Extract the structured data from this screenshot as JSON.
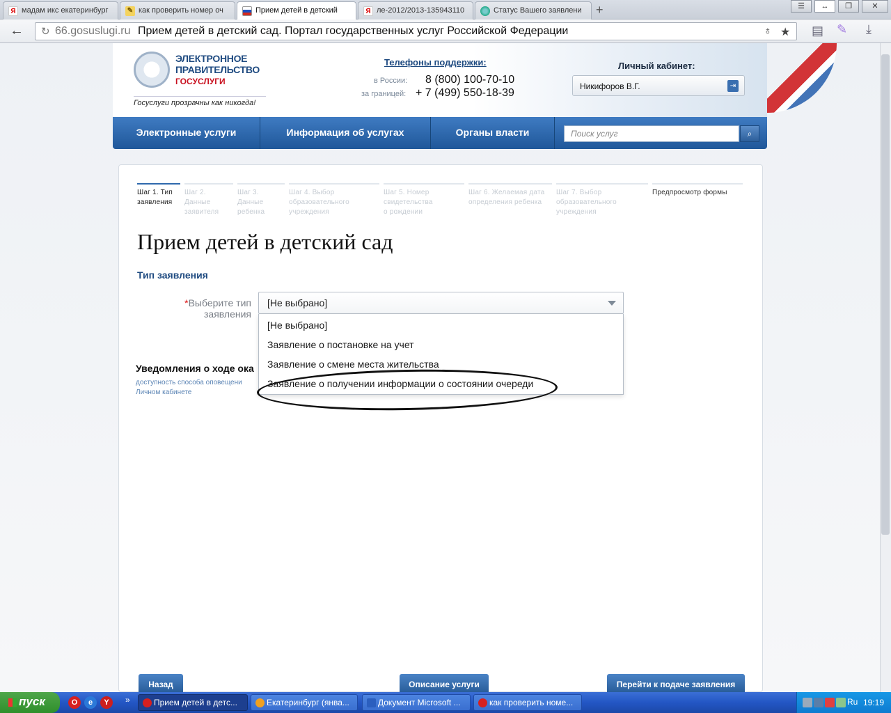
{
  "browser": {
    "tabs": [
      {
        "label": "мадам икс екатеринбург",
        "favicon": "yandex-icon"
      },
      {
        "label": "как проверить номер оч",
        "favicon": "document-icon"
      },
      {
        "label": "Прием детей в детский",
        "favicon": "russian-flag-icon",
        "active": true
      },
      {
        "label": "ле-2012/2013-135943110",
        "favicon": "yandex-icon"
      },
      {
        "label": "Статус Вашего заявлени",
        "favicon": "globe-icon"
      }
    ],
    "address_domain": "66.gosuslugi.ru",
    "address_title": "Прием детей в детский сад. Портал государственных услуг Российской Федерации"
  },
  "header": {
    "logo_line1": "ЭЛЕКТРОННОЕ",
    "logo_line2": "ПРАВИТЕЛЬСТВО",
    "logo_line3": "ГОСУСЛУГИ",
    "slogan": "Госуслуги прозрачны как никогда!",
    "phones_title": "Телефоны поддержки:",
    "phone_ru_label": "в России:",
    "phone_ru": "8 (800) 100-70-10",
    "phone_abroad_label": "за границей:",
    "phone_abroad": "+ 7 (499) 550-18-39",
    "cabinet_title": "Личный кабинет:",
    "cabinet_user": "Никифоров В.Г."
  },
  "nav": {
    "items": [
      "Электронные услуги",
      "Информация об услугах",
      "Органы власти"
    ],
    "search_placeholder": "Поиск услуг"
  },
  "steps": [
    {
      "line1": "Шаг 1. Тип",
      "line2": "заявления",
      "line3": "",
      "active": true
    },
    {
      "line1": "Шаг 2. Данные",
      "line2": "заявителя",
      "line3": ""
    },
    {
      "line1": "Шаг 3.",
      "line2": "Данные",
      "line3": "ребенка"
    },
    {
      "line1": "Шаг 4. Выбор",
      "line2": "образовательного",
      "line3": "учреждения"
    },
    {
      "line1": "Шаг 5. Номер",
      "line2": "свидетельства",
      "line3": "о рождении"
    },
    {
      "line1": "Шаг 6. Желаемая дата",
      "line2": "определения ребенка",
      "line3": ""
    },
    {
      "line1": "Шаг 7. Выбор",
      "line2": "образовательного",
      "line3": "учреждения"
    },
    {
      "line1": "Предпросмотр формы",
      "line2": "",
      "line3": ""
    }
  ],
  "form": {
    "page_title": "Прием детей в детский сад",
    "section_title": "Тип заявления",
    "field_required_mark": "*",
    "field_label_1": "Выберите тип",
    "field_label_2": "заявления",
    "select_value": "[Не выбрано]",
    "options": [
      "[Не выбрано]",
      "Заявление о постановке на учет",
      "Заявление о смене места жительства",
      "Заявление о получении информации о состоянии очереди"
    ],
    "notify_title": "Уведомления о ходе ока",
    "notify_hint_1": "доступность способа оповещени",
    "notify_hint_2": "Личном кабинете"
  },
  "buttons": {
    "back": "Назад",
    "description": "Описание услуги",
    "proceed": "Перейти к подаче заявления"
  },
  "taskbar": {
    "start": "пуск",
    "tasks": [
      {
        "label": "Прием детей в детс...",
        "active": true
      },
      {
        "label": "Екатеринбург (янва..."
      },
      {
        "label": "Документ Microsoft ..."
      },
      {
        "label": "как проверить номе..."
      }
    ],
    "lang": "Ru",
    "clock": "19:19"
  },
  "colors": {
    "brand_blue": "#1f5799",
    "brand_red": "#cf1f22",
    "accent_text": "#1e4a80"
  }
}
